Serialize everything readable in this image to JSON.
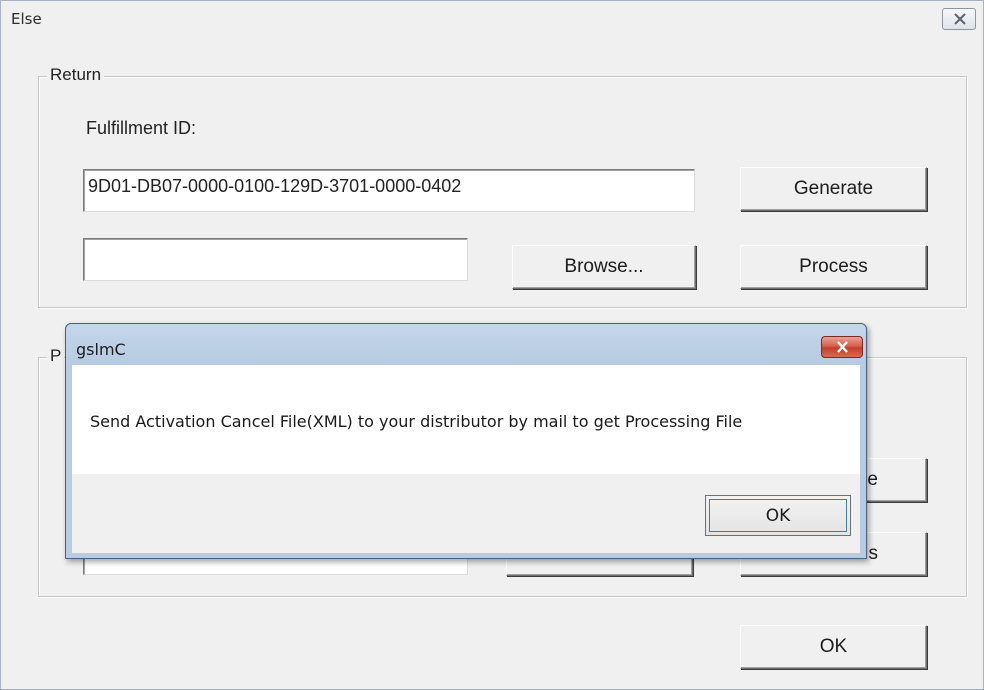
{
  "window": {
    "title": "Else"
  },
  "return_group": {
    "legend": "Return",
    "fulfillment_label": "Fulfillment ID:",
    "fulfillment_value": "9D01-DB07-0000-0100-129D-3701-0000-0402",
    "file_path_value": "",
    "generate_label": "Generate",
    "browse_label": "Browse...",
    "process_label": "Process"
  },
  "second_group": {
    "legend": "P",
    "button_top_fragment": "e",
    "button_bottom_fragment": "s",
    "file_path_value": ""
  },
  "footer": {
    "ok_label": "OK"
  },
  "message_box": {
    "title": "gslmC",
    "message": "Send Activation Cancel File(XML) to your distributor by mail to get Processing File",
    "ok_label": "OK"
  },
  "icons": {
    "main_close": "close-icon",
    "msg_close": "close-icon"
  }
}
